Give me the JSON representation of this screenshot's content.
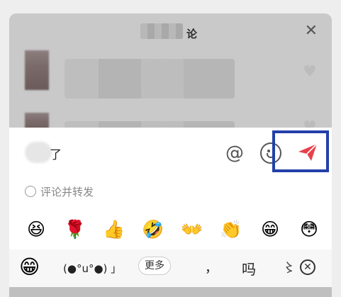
{
  "sheet": {
    "title_visible": "论",
    "close_label": "✕"
  },
  "input": {
    "text": "了"
  },
  "toolbar": {
    "at_label": "@"
  },
  "forward": {
    "label": "评论并转发"
  },
  "emoji_row": [
    "😆",
    "🌹",
    "👍",
    "🤣",
    "👐",
    "👏",
    "😁",
    "😳"
  ],
  "bottom_bar": {
    "emoji": "😁",
    "kaomoji": "(●°u°●)​ 」",
    "more_label": "更多",
    "comma": "，",
    "ma": "吗",
    "extra": "〻",
    "delete_label": "✕"
  },
  "colors": {
    "send": "#e8404a",
    "highlight": "#2340a8"
  },
  "icons": {
    "close": "close-icon",
    "at": "at-icon",
    "emoji": "smiley-icon",
    "send": "paper-plane-icon",
    "delete": "delete-icon"
  }
}
